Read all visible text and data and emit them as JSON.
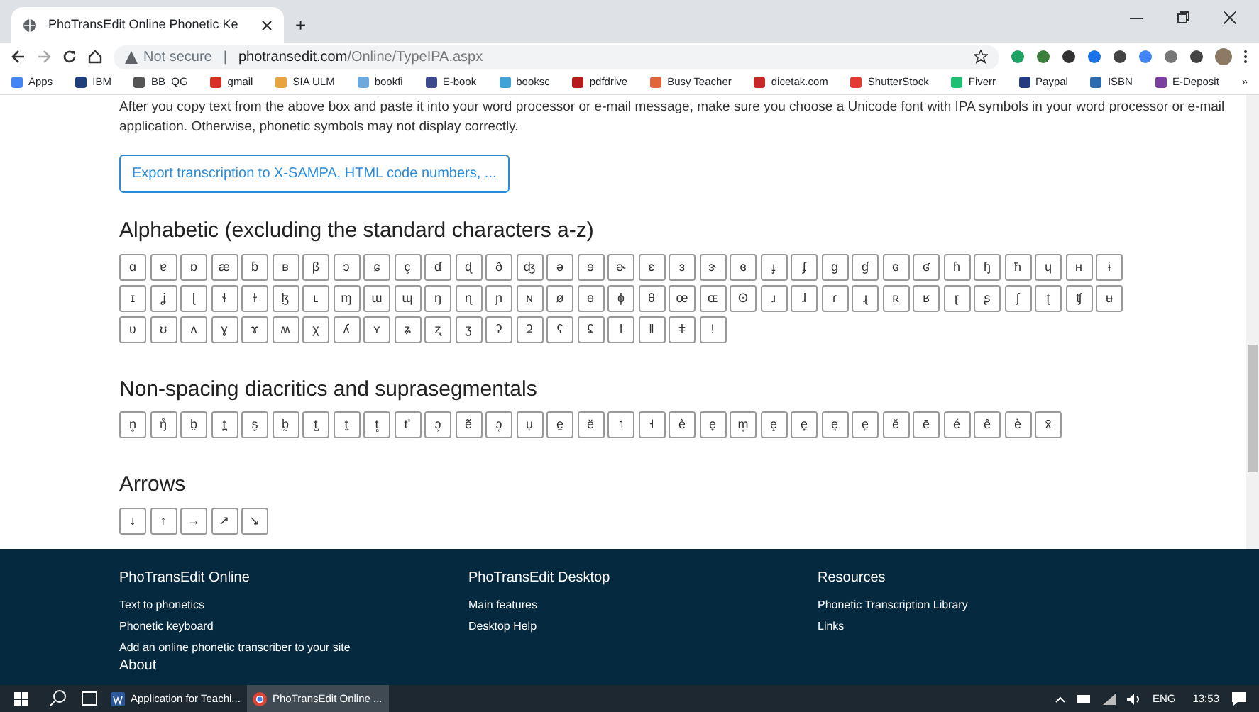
{
  "browser": {
    "tab_title": "PhoTransEdit Online Phonetic Ke",
    "new_tab": "+",
    "security": "Not secure",
    "separator": "|",
    "url_host": "photransedit.com",
    "url_path": "/Online/TypeIPA.aspx",
    "bookmarks": [
      {
        "label": "Apps",
        "color": "#4285f4"
      },
      {
        "label": "IBM",
        "color": "#1f3f7a"
      },
      {
        "label": "BB_QG",
        "color": "#555555"
      },
      {
        "label": "gmail",
        "color": "#d93025"
      },
      {
        "label": "SIA ULM",
        "color": "#e8a33d"
      },
      {
        "label": "bookfi",
        "color": "#6fa8dc"
      },
      {
        "label": "E-book",
        "color": "#3c4a8c"
      },
      {
        "label": "booksc",
        "color": "#3fa3d8"
      },
      {
        "label": "pdfdrive",
        "color": "#b71c1c"
      },
      {
        "label": "Busy Teacher",
        "color": "#e0663a"
      },
      {
        "label": "dicetak.com",
        "color": "#c62828"
      },
      {
        "label": "ShutterStock",
        "color": "#e53935"
      },
      {
        "label": "Fiverr",
        "color": "#1dbf73"
      },
      {
        "label": "Paypal",
        "color": "#253b80"
      },
      {
        "label": "ISBN",
        "color": "#2b6cb0"
      },
      {
        "label": "E-Deposit",
        "color": "#7b3fa0"
      }
    ],
    "more": "»"
  },
  "page": {
    "paragraph": "After you copy text from the above box and paste it into your word processor or e-mail message, make sure you choose a Unicode font with IPA symbols in your word processor or e-mail application. Otherwise, phonetic symbols may not display correctly.",
    "export_button": "Export transcription to X-SAMPA, HTML code numbers, ...",
    "sections": [
      {
        "title": "Alphabetic (excluding the standard characters a-z)",
        "rows": [
          [
            "ɑ",
            "ɐ",
            "ɒ",
            "æ",
            "ɓ",
            "ʙ",
            "β",
            "ɔ",
            "ɕ",
            "ç",
            "ɗ",
            "ɖ",
            "ð",
            "ʤ",
            "ə",
            "ɘ",
            "ɚ",
            "ɛ",
            "ɜ",
            "ɝ",
            "ɞ",
            "ɟ",
            "ʄ",
            "ɡ",
            "ɠ",
            "ɢ",
            "ʛ",
            "ɦ",
            "ɧ",
            "ħ",
            "ɥ",
            "ʜ",
            "ɨ"
          ],
          [
            "ɪ",
            "ʝ",
            "ɭ",
            "ɬ",
            "ɫ",
            "ɮ",
            "ʟ",
            "ɱ",
            "ɯ",
            "ɰ",
            "ŋ",
            "ɳ",
            "ɲ",
            "ɴ",
            "ø",
            "ɵ",
            "ɸ",
            "θ",
            "œ",
            "ɶ",
            "ʘ",
            "ɹ",
            "ɺ",
            "ɾ",
            "ɻ",
            "ʀ",
            "ʁ",
            "ɽ",
            "ʂ",
            "ʃ",
            "ʈ",
            "ʧ",
            "ʉ"
          ],
          [
            "ʋ",
            "ʊ",
            "ʌ",
            "ɣ",
            "ɤ",
            "ʍ",
            "χ",
            "ʎ",
            "ʏ",
            "ʑ",
            "ʐ",
            "ʒ",
            "ʔ",
            "ʡ",
            "ʕ",
            "ʢ",
            "ǀ",
            "ǁ",
            "ǂ",
            "ǃ"
          ]
        ]
      },
      {
        "title": "Non-spacing diacritics and suprasegmentals",
        "rows": [
          [
            "n̥",
            "ŋ̊",
            "b̤",
            "t̪",
            "s̬",
            "b̰",
            "t̺",
            "t̼",
            "t̻",
            "tʼ",
            "ɔ̹",
            "ẽ",
            "ɔ̜",
            "u̟",
            "e̠",
            "ë",
            "˦",
            "˧",
            "è",
            "e̞",
            "m̩",
            "e̝",
            "e̞",
            "e̘",
            "e̙",
            "ě",
            "ē",
            "é",
            "ê",
            "è",
            "x̄"
          ]
        ]
      },
      {
        "title": "Arrows",
        "rows": [
          [
            "↓",
            "↑",
            "→",
            "↗",
            "↘"
          ]
        ]
      }
    ]
  },
  "footer": {
    "columns": [
      {
        "title": "PhoTransEdit Online",
        "links": [
          "Text to phonetics",
          "Phonetic keyboard",
          "Add an online phonetic transcriber to your site"
        ]
      },
      {
        "title": "PhoTransEdit Desktop",
        "links": [
          "Main features",
          "Desktop Help"
        ]
      },
      {
        "title": "Resources",
        "links": [
          "Phonetic Transcription Library",
          "Links"
        ]
      }
    ],
    "next_title": "About"
  },
  "taskbar": {
    "apps": [
      {
        "label": "Application for Teachi...",
        "kind": "word",
        "selected": false
      },
      {
        "label": "PhoTransEdit Online ...",
        "kind": "browser",
        "selected": true
      }
    ],
    "language": "ENG",
    "time": "13:53"
  }
}
